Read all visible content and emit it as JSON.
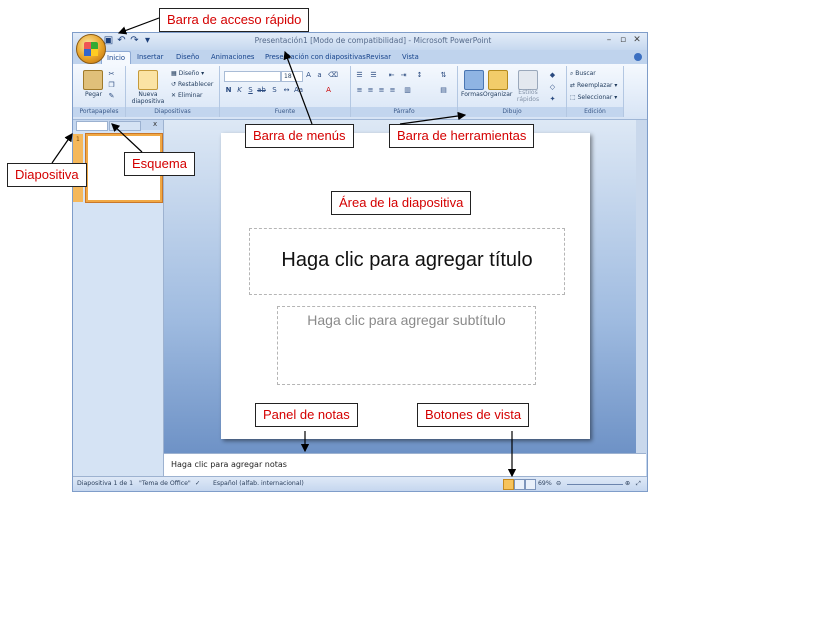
{
  "window": {
    "title": "Presentación1 [Modo de compatibilidad] - Microsoft PowerPoint",
    "qat_icons": [
      "save-icon",
      "undo-icon",
      "redo-icon",
      "customize-icon"
    ],
    "controls": [
      "–",
      "▫",
      "✕"
    ]
  },
  "ribbon": {
    "tabs": [
      {
        "label": "Inicio",
        "active": true
      },
      {
        "label": "Insertar"
      },
      {
        "label": "Diseño"
      },
      {
        "label": "Animaciones"
      },
      {
        "label": "Presentación con diapositivas"
      },
      {
        "label": "Revisar"
      },
      {
        "label": "Vista"
      }
    ],
    "groups": {
      "portapapeles": {
        "label": "Portapapeles",
        "paste": "Pegar"
      },
      "diapositivas": {
        "label": "Diapositivas",
        "new_slide": "Nueva diapositiva",
        "layout": "Diseño",
        "reset": "Restablecer",
        "delete": "Eliminar"
      },
      "fuente": {
        "label": "Fuente",
        "size": "18"
      },
      "parrafo": {
        "label": "Párrafo"
      },
      "dibujo": {
        "label": "Dibujo",
        "shapes": "Formas",
        "arrange": "Organizar",
        "quick_styles": "Estilos rápidos"
      },
      "edicion": {
        "label": "Edición",
        "find": "Buscar",
        "replace": "Reemplazar",
        "select": "Seleccionar"
      }
    }
  },
  "slide": {
    "number": "1",
    "title_placeholder": "Haga clic para agregar título",
    "subtitle_placeholder": "Haga clic para agregar subtítulo"
  },
  "notes": {
    "placeholder": "Haga clic para agregar notas"
  },
  "status_bar": {
    "slide_info": "Diapositiva 1 de 1",
    "theme": "\"Tema de Office\"",
    "language": "Español (alfab. internacional)",
    "zoom": "69%"
  },
  "callouts": {
    "quick_access": "Barra de acceso rápido",
    "menu_bar": "Barra de menús",
    "toolbar": "Barra de herramientas",
    "slide_pane": "Diapositiva",
    "outline": "Esquema",
    "slide_area": "Área de la diapositiva",
    "notes_panel": "Panel de notas",
    "view_buttons": "Botones de vista"
  },
  "colors": {
    "callout_text": "#d40000",
    "ribbon_text": "#15428b",
    "thumbnail_border": "#f0a844"
  }
}
